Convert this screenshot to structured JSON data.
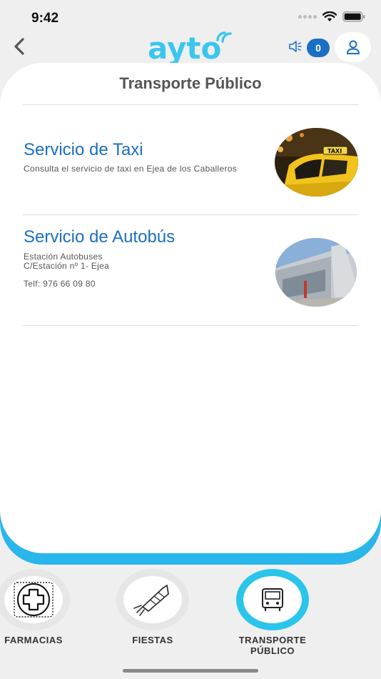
{
  "status_bar": {
    "time": "9:42"
  },
  "header": {
    "logo_text": "ayto",
    "badge_count": "0"
  },
  "page": {
    "title": "Transporte Público"
  },
  "services": [
    {
      "title": "Servicio de Taxi",
      "lines": [
        "Consulta el servicio de taxi en Ejea de los Caballeros"
      ],
      "photo_label": "TAXI"
    },
    {
      "title": "Servicio de Autobús",
      "lines": [
        "Estación Autobuses",
        "C/Estación nº 1- Ejea",
        "",
        "Telf: 976 66 09 80"
      ]
    }
  ],
  "bottom_nav": [
    {
      "label": "FARMACIAS",
      "icon": "pharmacy-cross-icon"
    },
    {
      "label": "FIESTAS",
      "icon": "firework-rocket-icon"
    },
    {
      "label_line1": "TRANSPORTE",
      "label_line2": "PÚBLICO",
      "icon": "bus-icon",
      "active": true
    }
  ],
  "colors": {
    "accent_blue": "#1a6fc2",
    "cyan": "#29b6ea",
    "background": "#efefef"
  }
}
